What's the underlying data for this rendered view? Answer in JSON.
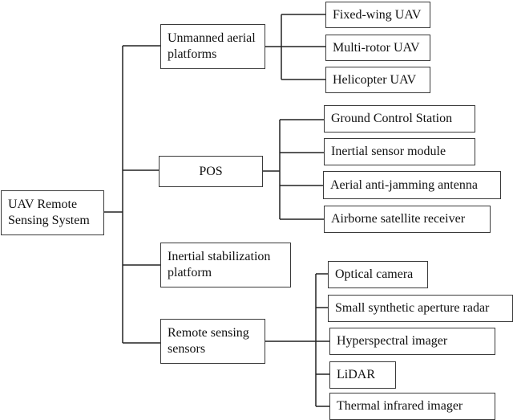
{
  "diagram": {
    "type": "hierarchy-tree",
    "root": {
      "id": "root",
      "label": "UAV Remote Sensing System"
    },
    "branches": [
      {
        "id": "uav-platforms",
        "label": "Unmanned aerial platforms",
        "children": [
          {
            "id": "fixed-wing",
            "label": "Fixed-wing UAV"
          },
          {
            "id": "multi-rotor",
            "label": "Multi-rotor UAV"
          },
          {
            "id": "helicopter",
            "label": "Helicopter UAV"
          }
        ]
      },
      {
        "id": "pos",
        "label": "POS",
        "children": [
          {
            "id": "gcs",
            "label": "Ground Control Station"
          },
          {
            "id": "ism",
            "label": "Inertial sensor module"
          },
          {
            "id": "aaja",
            "label": "Aerial anti-jamming antenna"
          },
          {
            "id": "asr",
            "label": "Airborne satellite receiver"
          }
        ]
      },
      {
        "id": "isp",
        "label": "Inertial stabilization platform",
        "children": []
      },
      {
        "id": "rss",
        "label": "Remote sensing sensors",
        "children": [
          {
            "id": "optical",
            "label": "Optical camera"
          },
          {
            "id": "sar",
            "label": "Small synthetic aperture radar"
          },
          {
            "id": "hyper",
            "label": "Hyperspectral imager"
          },
          {
            "id": "lidar",
            "label": "LiDAR"
          },
          {
            "id": "thermal",
            "label": "Thermal infrared imager"
          }
        ]
      }
    ]
  },
  "labels": {
    "root_line1": "UAV Remote",
    "root_line2": "Sensing System",
    "uav_line1": "Unmanned aerial",
    "uav_line2": "platforms",
    "pos": "POS",
    "isp_line1": "Inertial stabilization",
    "isp_line2": "platform",
    "rss_line1": "Remote sensing",
    "rss_line2": "sensors",
    "fixed_wing": "Fixed-wing UAV",
    "multi_rotor": "Multi-rotor UAV",
    "helicopter": "Helicopter UAV",
    "gcs": "Ground Control Station",
    "ism": "Inertial sensor module",
    "aaja": "Aerial anti-jamming antenna",
    "asr": "Airborne satellite receiver",
    "optical": "Optical camera",
    "sar": "Small synthetic aperture radar",
    "hyper": "Hyperspectral imager",
    "lidar": "LiDAR",
    "thermal": "Thermal infrared imager"
  },
  "colors": {
    "line": "#222222",
    "border": "#3a3a3a",
    "text": "#111111",
    "background": "#ffffff"
  }
}
